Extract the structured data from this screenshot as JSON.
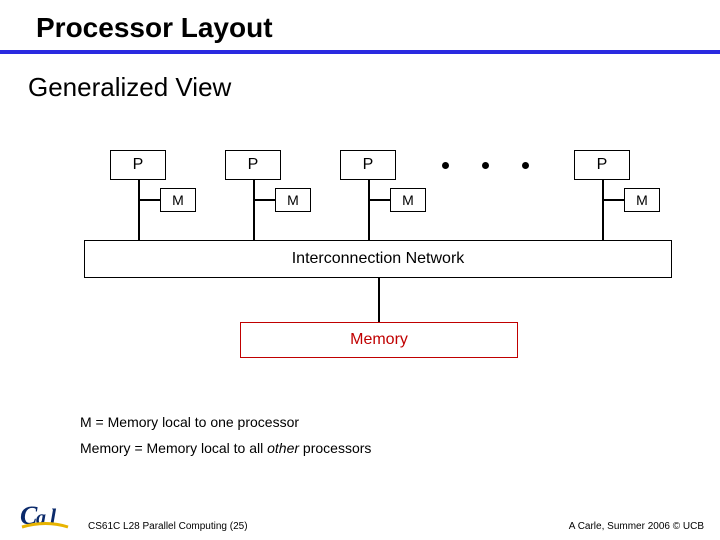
{
  "title": "Processor Layout",
  "section": "Generalized View",
  "proc_label": "P",
  "mem_label": "M",
  "interconnect": "Interconnection Network",
  "memory": "Memory",
  "note1": "M = Memory local to one processor",
  "note2": "Memory = Memory local to all other processors",
  "note2_italic": "other",
  "footer_left": "CS61C L28 Parallel Computing (25)",
  "footer_right": "A Carle, Summer 2006 © UCB",
  "logo_alt": "Cal"
}
